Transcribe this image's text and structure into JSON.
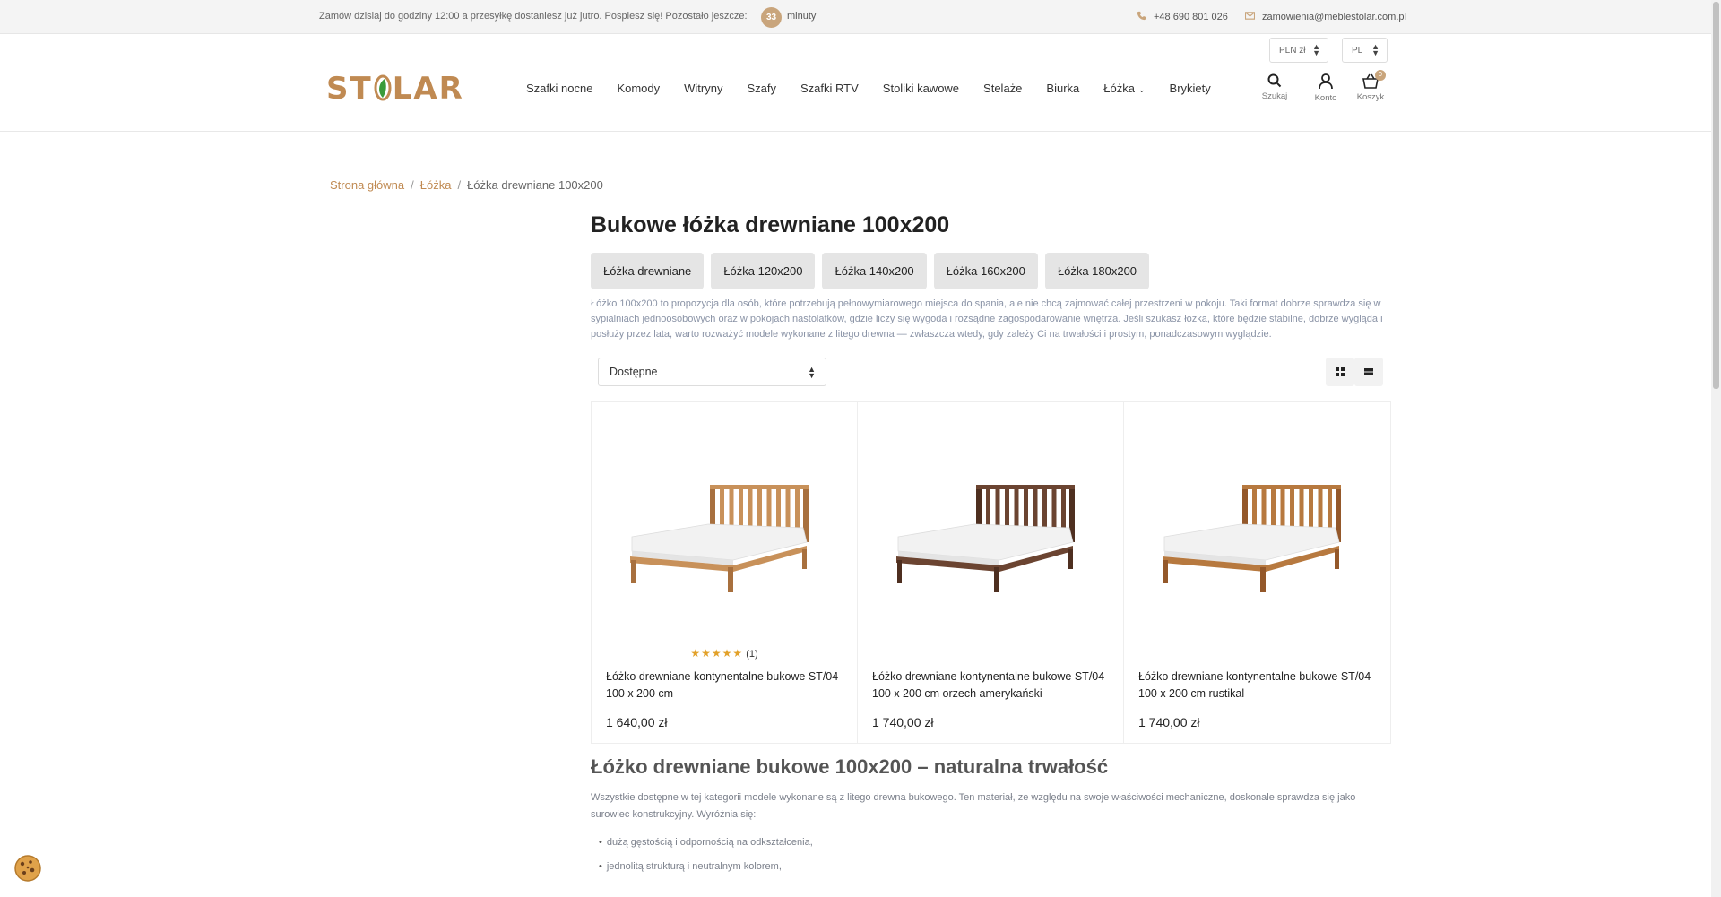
{
  "topbar": {
    "promo": "Zamów dzisiaj do godziny 12:00 a przesyłkę dostaniesz już jutro. Pospiesz się! Pozostało jeszcze:",
    "countdown": "33",
    "minutes": "minuty",
    "phone": "+48 690 801 026",
    "email": "zamowienia@meblestolar.com.pl",
    "accent_color": "#c9a57c"
  },
  "header": {
    "currency": "PLN zł",
    "language": "PL",
    "logo_text": "STOLAR",
    "logo_color": "#c08a52",
    "nav": [
      "Szafki nocne",
      "Komody",
      "Witryny",
      "Szafy",
      "Szafki RTV",
      "Stoliki kawowe",
      "Stelaże",
      "Biurka",
      "Łóżka",
      "Brykiety"
    ],
    "icons": {
      "search": {
        "icon": "search-icon",
        "label": "Szukaj"
      },
      "account": {
        "icon": "user-icon",
        "label": "Konto"
      },
      "cart": {
        "icon": "basket-icon",
        "label": "Koszyk",
        "count": "0"
      }
    }
  },
  "breadcrumb": {
    "home": "Strona główna",
    "beds": "Łóżka",
    "current": "Łóżka drewniane 100x200"
  },
  "page": {
    "title": "Bukowe łóżka drewniane 100x200",
    "chips": [
      "Łóżka drewniane",
      "Łóżka 120x200",
      "Łóżka 140x200",
      "Łóżka 160x200",
      "Łóżka 180x200"
    ],
    "intro": "Łóżko 100x200 to propozycja dla osób, które potrzebują pełnowymiarowego miejsca do spania, ale nie chcą zajmować całej przestrzeni w pokoju. Taki format dobrze sprawdza się w sypialniach jednoosobowych oraz w pokojach nastolatków, gdzie liczy się wygoda i rozsądne zagospodarowanie wnętrza. Jeśli szukasz łóżka, które będzie stabilne, dobrze wygląda i posłuży przez lata, warto rozważyć modele wykonane z litego drewna — zwłaszcza wtedy, gdy zależy Ci na trwałości i prostym, ponadczasowym wyglądzie.",
    "sort_value": "Dostępne"
  },
  "products": [
    {
      "name": "Łóżko drewniane kontynentalne bukowe ST/04 100 x 200 cm",
      "price": "1 640,00 zł",
      "stars": "★★★★★",
      "reviews": "(1)",
      "wood_color": "#c8915a",
      "wood_dark": "#a8703e"
    },
    {
      "name": "Łóżko drewniane kontynentalne bukowe ST/04 100 x 200 cm orzech amerykański",
      "price": "1 740,00 zł",
      "stars": "",
      "reviews": "",
      "wood_color": "#6b4431",
      "wood_dark": "#4e2f20"
    },
    {
      "name": "Łóżko drewniane kontynentalne bukowe ST/04 100 x 200 cm rustikal",
      "price": "1 740,00 zł",
      "stars": "",
      "reviews": "",
      "wood_color": "#b7793f",
      "wood_dark": "#94582a"
    }
  ],
  "section": {
    "title": "Łóżko drewniane bukowe 100x200 – naturalna trwałość",
    "text": "Wszystkie dostępne w tej kategorii modele wykonane są z litego drewna bukowego. Ten materiał, ze względu na swoje właściwości mechaniczne, doskonale sprawdza się jako surowiec konstrukcyjny. Wyróżnia się:",
    "bullets": [
      "dużą gęstością i odpornością na odkształcenia,",
      "jednolitą strukturą i neutralnym kolorem,"
    ]
  }
}
